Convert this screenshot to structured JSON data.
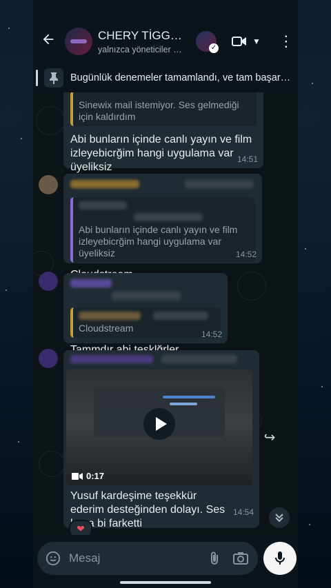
{
  "header": {
    "group_name": "CHERY TİGGO...",
    "subtitle": "yalnızca yöneticiler m...",
    "verified_glyph": "✓"
  },
  "pinned": {
    "text": "Bugünlük denemeler tamamlandı, ve tam başarılı..."
  },
  "messages": [
    {
      "quote_text": "Sinewix mail istemiyor. Ses gelmediği için kaldırdım",
      "text": "Abi bunların içinde  canlı yayın ve film izleyebicrğim  hangi uygulama var üyeliksiz",
      "time": "14:51"
    },
    {
      "quote_text": "Abi bunların içinde  canlı yayın ve film izleyebicrğim  hangi uygulama var üyeliksiz",
      "text": "Cloudstream",
      "time": "14:52"
    },
    {
      "quote_text": "Cloudstream",
      "text": "Tammdır abi teşklğrler",
      "time": "14:52"
    },
    {
      "video_duration": "0:17",
      "text": "Yusuf kardeşime teşekkür ederim desteğinden dolayı. Ses baya bi farketti",
      "time": "14:54",
      "reaction": "❤"
    }
  ],
  "footer": {
    "placeholder": "Mesaj"
  },
  "icons": {
    "back": "←",
    "more": "⋮",
    "forward": "↪",
    "scroll_down": "⌄"
  },
  "colors": {
    "background": "#0b141a",
    "bubble": "#202c33",
    "quote_gold": "#c79a3a",
    "quote_purple": "#8a6ed8"
  }
}
